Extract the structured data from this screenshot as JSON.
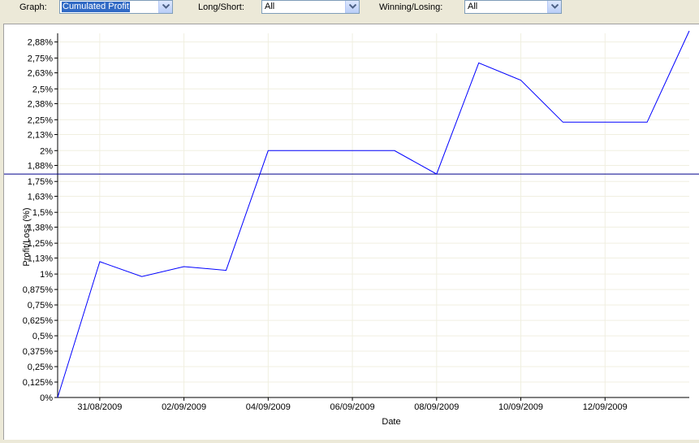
{
  "controls": {
    "graph": {
      "label": "Graph:",
      "value": "Cumulated Profit"
    },
    "long_short": {
      "label": "Long/Short:",
      "value": "All"
    },
    "winning_losing": {
      "label": "Winning/Losing:",
      "value": "All"
    }
  },
  "icons": {
    "dropdown": "chevron-down-icon"
  },
  "colors": {
    "line": "#0000ff",
    "reference": "#00008b",
    "grid": "#f0efe0"
  },
  "chart_data": {
    "type": "line",
    "xlabel": "Date",
    "ylabel": "Profit/Loss (%)",
    "x_ticks": [
      "31/08/2009",
      "02/09/2009",
      "04/09/2009",
      "06/09/2009",
      "08/09/2009",
      "10/09/2009",
      "12/09/2009"
    ],
    "y_ticks": [
      "0%",
      "0,125%",
      "0,25%",
      "0,375%",
      "0,5%",
      "0,625%",
      "0,75%",
      "0,875%",
      "1%",
      "1,13%",
      "1,25%",
      "1,38%",
      "1,5%",
      "1,63%",
      "1,75%",
      "1,88%",
      "2%",
      "2,13%",
      "2,25%",
      "2,38%",
      "2,5%",
      "2,63%",
      "2,75%",
      "2,88%"
    ],
    "ylim": [
      0,
      2.95
    ],
    "xlim": [
      "30/08/2009",
      "14/09/2009"
    ],
    "series": [
      {
        "x": [
          "30/08/2009",
          "31/08/2009",
          "01/09/2009",
          "02/09/2009",
          "03/09/2009",
          "04/09/2009",
          "07/09/2009",
          "08/09/2009",
          "09/09/2009",
          "10/09/2009",
          "11/09/2009",
          "13/09/2009",
          "14/09/2009"
        ],
        "y": [
          0,
          1.1,
          0.98,
          1.06,
          1.03,
          2.0,
          2.0,
          1.81,
          2.71,
          2.57,
          2.23,
          2.23,
          2.97
        ]
      }
    ],
    "reference_line": 1.81,
    "grid": true
  }
}
